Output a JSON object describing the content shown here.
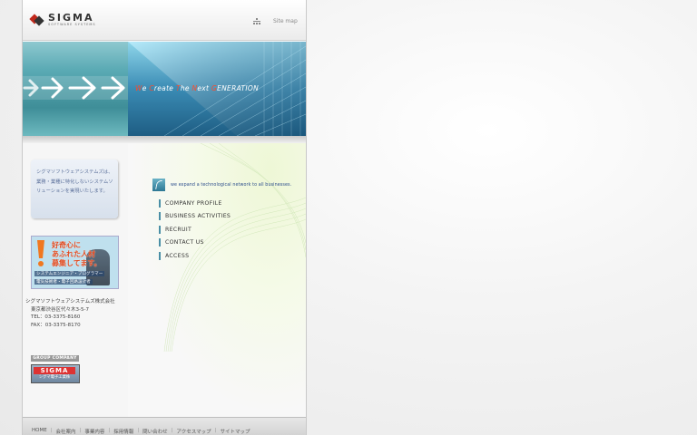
{
  "header": {
    "logo_main": "SIGMA",
    "logo_sub": "SOFTWARE SYSTEMS",
    "sitemap_label": "Site map"
  },
  "banner": {
    "slogan_parts": [
      {
        "cap": "W",
        "rest": "e "
      },
      {
        "cap": "C",
        "rest": "reate "
      },
      {
        "cap": "T",
        "rest": "he "
      },
      {
        "cap": "N",
        "rest": "ext "
      },
      {
        "cap": "G",
        "rest": "ENERATION"
      }
    ]
  },
  "sidebar": {
    "intro": "シグマソフトウェアシステムズは、業務・業種に特化しないシステムソリューションを実現いたします。",
    "recruit": {
      "headline": "好奇心に\nあふれた人材\n募集してます。",
      "sub1": "システムエンジニア・プログラマー",
      "sub2": "電気技術者・電子回路設計者"
    },
    "company": {
      "name": "シグマソフトウェアシステムズ株式会社",
      "address": "東京都渋谷区代々木3-5-7",
      "tel": "TEL：03-3375-8160",
      "fax": "FAX：03-3375-8170"
    },
    "group_label": "GROUP COMPANY",
    "group_logo_main": "SIGMA",
    "group_logo_sub": "シグマ電子工業株"
  },
  "main": {
    "tagline": "we expand a technological network to all businesses.",
    "menu": [
      {
        "label": "COMPANY PROFILE"
      },
      {
        "label": "BUSINESS ACTIVITIES"
      },
      {
        "label": "RECRUIT"
      },
      {
        "label": "CONTACT US"
      },
      {
        "label": "ACCESS"
      }
    ]
  },
  "footer": {
    "links": [
      "HOME",
      "会社案内",
      "事業内容",
      "採用情報",
      "問い合わせ",
      "アクセスマップ",
      "サイトマップ"
    ],
    "separator": "|"
  },
  "colors": {
    "accent": "#2c4e8c",
    "slogan_cap": "#ff4a2a",
    "menu_bar": "#4a8fa6"
  }
}
